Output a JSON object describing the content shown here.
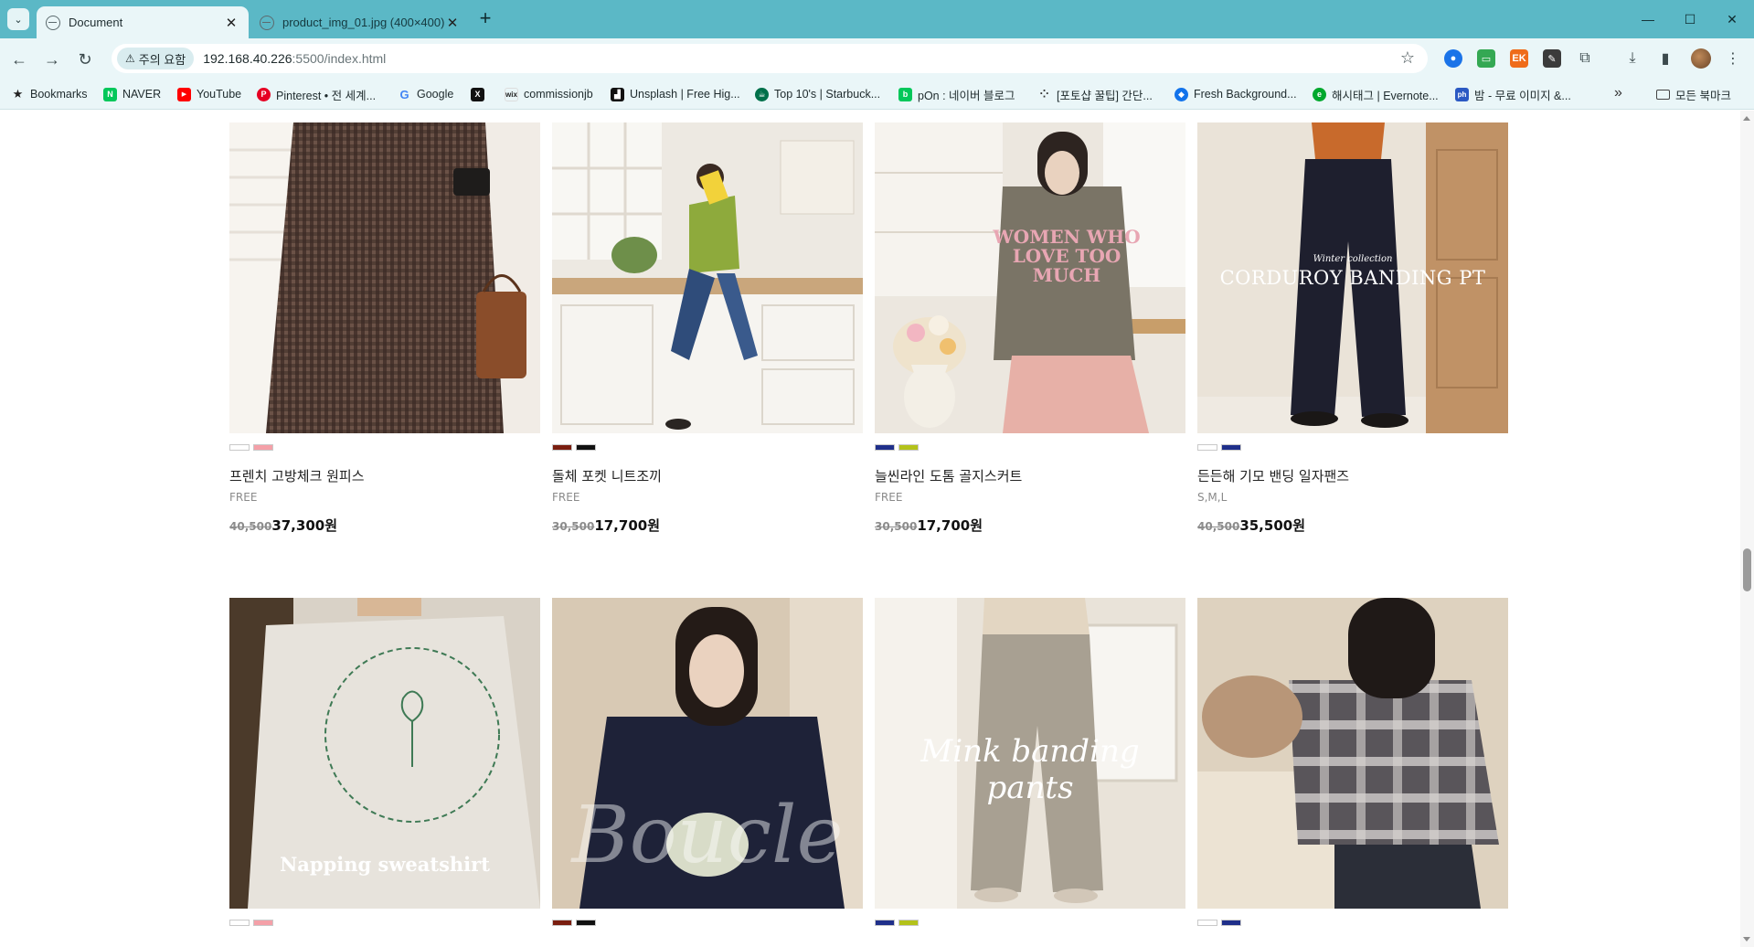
{
  "browser": {
    "tabs": [
      {
        "title": "Document",
        "active": true
      },
      {
        "title": "product_img_01.jpg (400×400)",
        "active": false
      }
    ],
    "address": {
      "security_label": "주의 요함",
      "host": "192.168.40.226",
      "rest": ":5500/index.html"
    },
    "bookmarks": [
      {
        "label": "Bookmarks",
        "icon": "star-icon",
        "color": "#222222"
      },
      {
        "label": "NAVER",
        "icon": "naver-icon",
        "color": "#03c75a"
      },
      {
        "label": "YouTube",
        "icon": "youtube-icon",
        "color": "#ff0000"
      },
      {
        "label": "Pinterest • 전 세계...",
        "icon": "pinterest-icon",
        "color": "#e60023"
      },
      {
        "label": "Google",
        "icon": "google-icon",
        "color": "#4285f4"
      },
      {
        "label": "",
        "icon": "x-icon",
        "color": "#111111"
      },
      {
        "label": "commissionjb",
        "icon": "wix-icon",
        "color": "#222222"
      },
      {
        "label": "Unsplash | Free Hig...",
        "icon": "unsplash-icon",
        "color": "#111111"
      },
      {
        "label": "Top 10's | Starbuck...",
        "icon": "starbucks-icon",
        "color": "#00704a"
      },
      {
        "label": "pOn : 네이버 블로그",
        "icon": "blog-icon",
        "color": "#03c75a"
      },
      {
        "label": "[포토샵 꿀팁] 간단...",
        "icon": "dots-icon",
        "color": "#333333"
      },
      {
        "label": "Fresh Background...",
        "icon": "freepik-icon",
        "color": "#1273eb"
      },
      {
        "label": "해시태그 | Evernote...",
        "icon": "evernote-icon",
        "color": "#00a82d"
      },
      {
        "label": "밤 - 무료 이미지 &...",
        "icon": "ph-icon",
        "color": "#2b59c3"
      }
    ],
    "bookmarks_folder": "모든 북마크"
  },
  "products": [
    {
      "name": "프렌치 고방체크 원피스",
      "size": "FREE",
      "old_price": "40,500",
      "price": "37,300원",
      "swatches": [
        "#ffffff",
        "#f4a0a8"
      ]
    },
    {
      "name": "돌체 포켓 니트조끼",
      "size": "FREE",
      "old_price": "30,500",
      "price": "17,700원",
      "swatches": [
        "#7a1e10",
        "#111111"
      ]
    },
    {
      "name": "늘씬라인 도톰 골지스커트",
      "size": "FREE",
      "old_price": "30,500",
      "price": "17,700원",
      "swatches": [
        "#1f2f8a",
        "#b3c21a"
      ]
    },
    {
      "name": "든든해 기모 밴딩 일자팬즈",
      "size": "S,M,L",
      "old_price": "40,500",
      "price": "35,500원",
      "swatches": [
        "#ffffff",
        "#1f2f8a"
      ]
    },
    {
      "name": "",
      "size": "",
      "old_price": "",
      "price": "",
      "swatches": [
        "#ffffff",
        "#f4a0a8"
      ]
    },
    {
      "name": "",
      "size": "",
      "old_price": "",
      "price": "",
      "swatches": [
        "#7a1e10",
        "#111111"
      ]
    },
    {
      "name": "",
      "size": "",
      "old_price": "",
      "price": "",
      "swatches": [
        "#1f2f8a",
        "#b3c21a"
      ]
    },
    {
      "name": "",
      "size": "",
      "old_price": "",
      "price": "",
      "swatches": [
        "#ffffff",
        "#1f2f8a"
      ]
    }
  ],
  "photo_captions": {
    "p2_sweat": "WOMEN WHO LOVE TOO MUCH",
    "p3_title": "CORDUROY BANDING PT",
    "p3_sub": "Winter collection",
    "p4_title": "Napping sweatshirt",
    "p5_title": "Boucle",
    "p6_title": "Mink banding pants"
  }
}
